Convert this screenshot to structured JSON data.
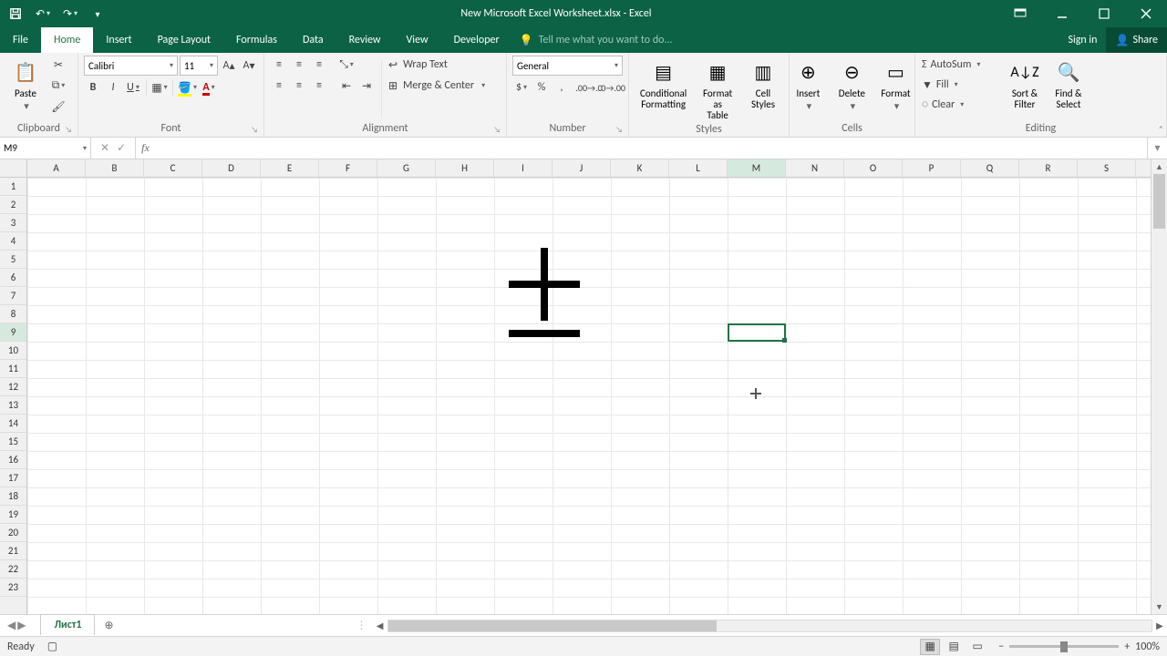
{
  "titlebar": {
    "title": "New Microsoft Excel Worksheet.xlsx - Excel"
  },
  "menubar": {
    "tabs": [
      "File",
      "Home",
      "Insert",
      "Page Layout",
      "Formulas",
      "Data",
      "Review",
      "View",
      "Developer"
    ],
    "active_index": 1,
    "tellme": "Tell me what you want to do...",
    "signin": "Sign in",
    "share": "Share"
  },
  "ribbon": {
    "clipboard": {
      "paste": "Paste",
      "label": "Clipboard"
    },
    "font": {
      "name": "Calibri",
      "size": "11",
      "bold": "B",
      "italic": "I",
      "underline": "U",
      "label": "Font"
    },
    "alignment": {
      "wrap": "Wrap Text",
      "merge": "Merge & Center",
      "label": "Alignment"
    },
    "number": {
      "format": "General",
      "label": "Number"
    },
    "styles": {
      "cond": "Conditional\nFormatting",
      "fat": "Format as\nTable",
      "cell": "Cell\nStyles",
      "label": "Styles"
    },
    "cells": {
      "insert": "Insert",
      "delete": "Delete",
      "format": "Format",
      "label": "Cells"
    },
    "editing": {
      "autosum": "AutoSum",
      "fill": "Fill",
      "clear": "Clear",
      "sort": "Sort &\nFilter",
      "find": "Find &\nSelect",
      "label": "Editing"
    }
  },
  "formulabar": {
    "namebox": "M9",
    "formula": ""
  },
  "grid": {
    "columns": [
      "A",
      "B",
      "C",
      "D",
      "E",
      "F",
      "G",
      "H",
      "I",
      "J",
      "K",
      "L",
      "M",
      "N",
      "O",
      "P",
      "Q",
      "R",
      "S"
    ],
    "rows": [
      "1",
      "2",
      "3",
      "4",
      "5",
      "6",
      "7",
      "8",
      "9",
      "10",
      "11",
      "12",
      "13",
      "14",
      "15",
      "16",
      "17",
      "18",
      "19",
      "20",
      "21",
      "22",
      "23"
    ],
    "selected": {
      "col": 12,
      "row": 8
    }
  },
  "sheetbar": {
    "sheet1": "Лист1"
  },
  "statusbar": {
    "ready": "Ready",
    "zoom": "100%"
  }
}
